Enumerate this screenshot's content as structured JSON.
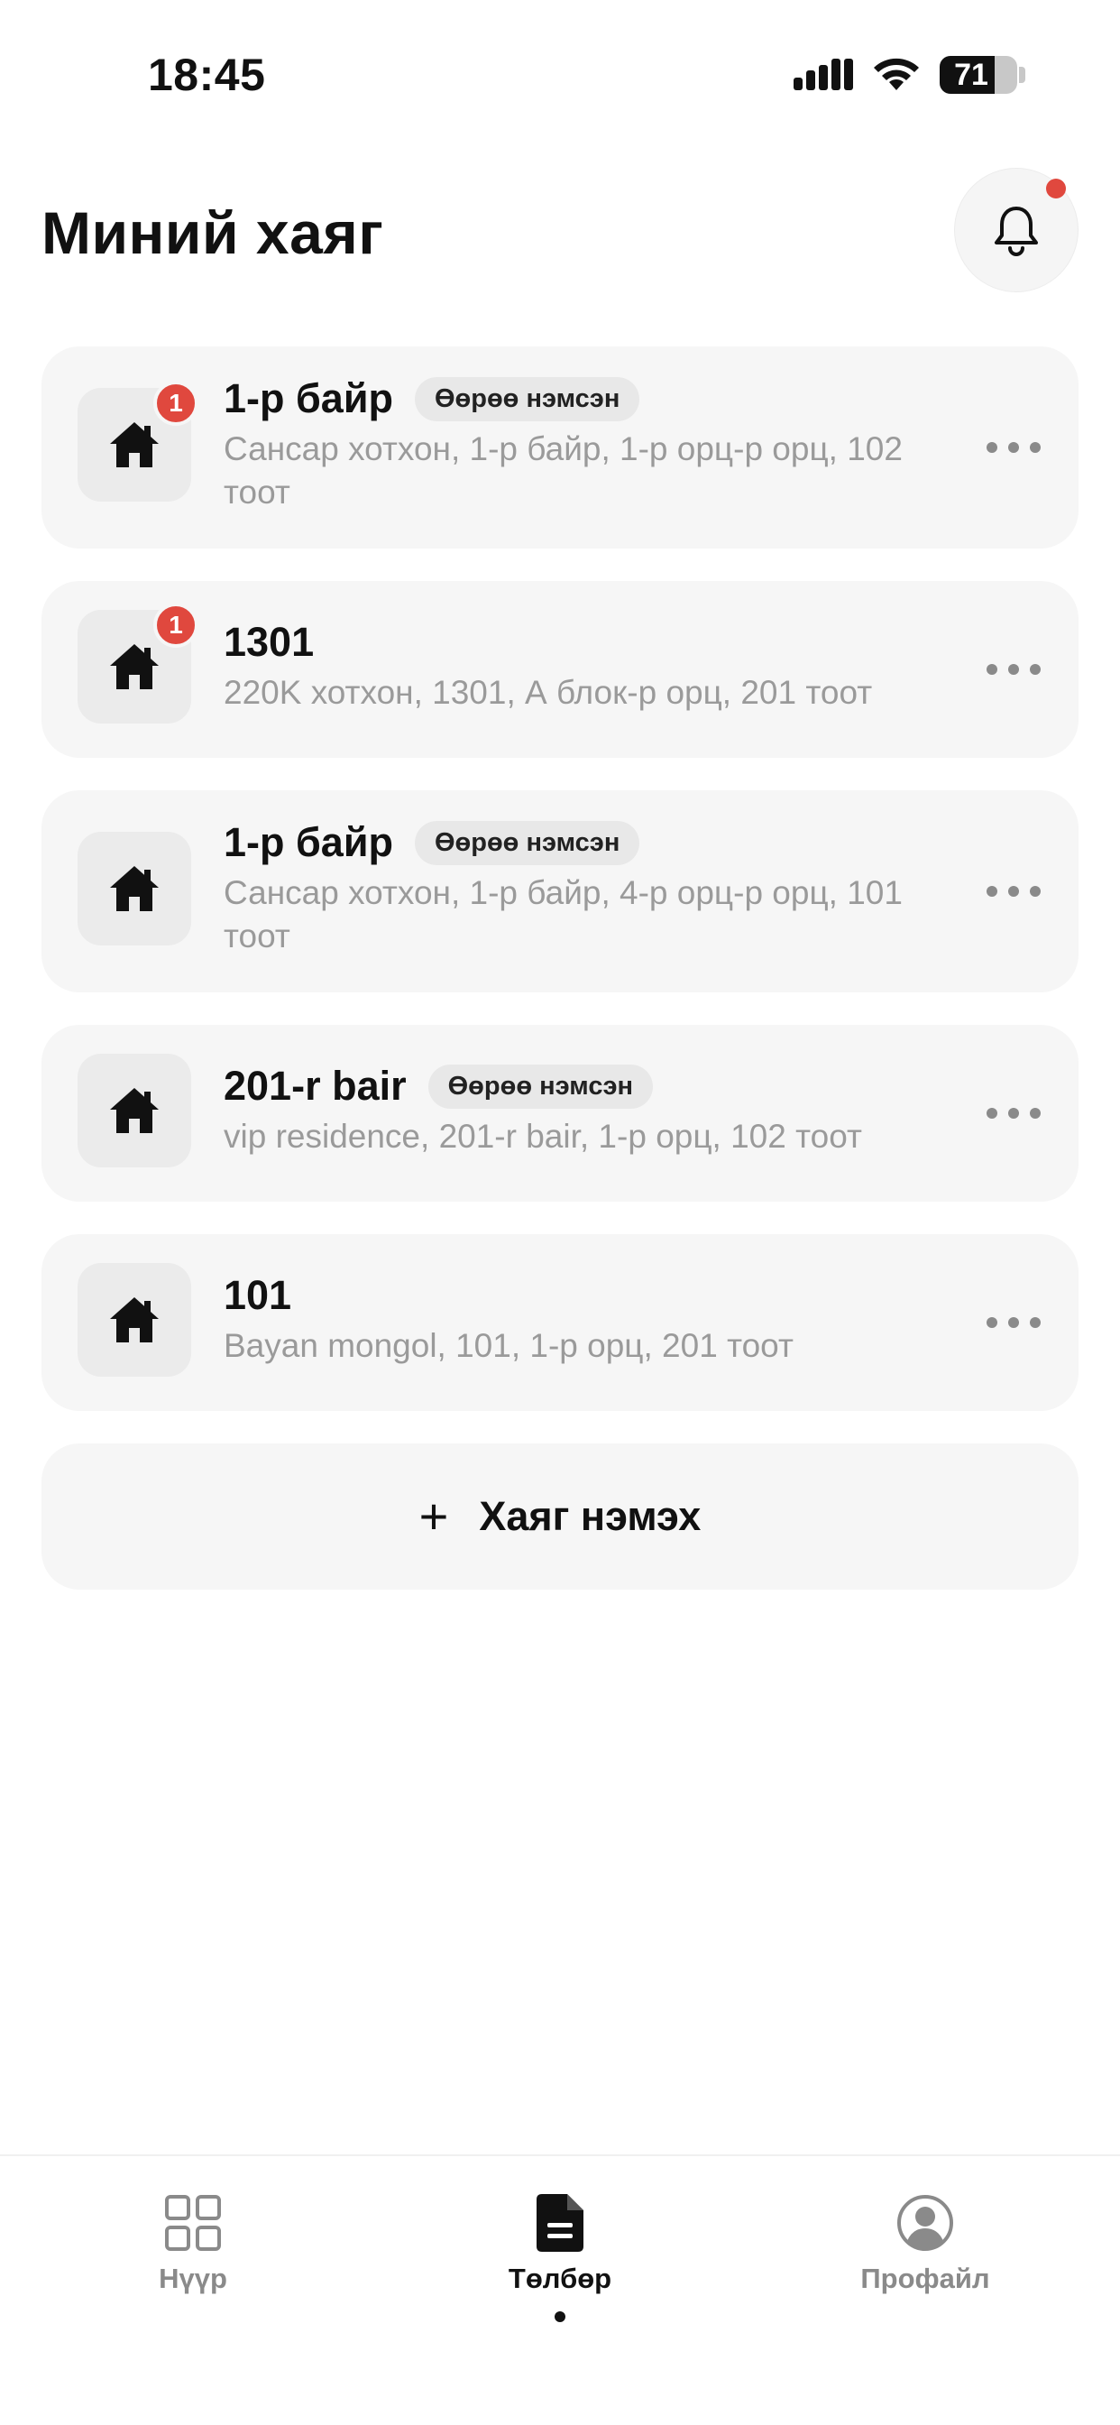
{
  "status_bar": {
    "time": "18:45",
    "battery": "71"
  },
  "header": {
    "title": "Миний хаяг"
  },
  "addresses": [
    {
      "title": "1-р байр",
      "tag": "Өөрөө нэмсэн",
      "subtitle": "Сансар хотхон, 1-р байр, 1-р орц-р орц, 102 тоот",
      "badge": "1"
    },
    {
      "title": "1301",
      "tag": "",
      "subtitle": "220K хотхон, 1301, А блок-р орц, 201 тоот",
      "badge": "1"
    },
    {
      "title": "1-р байр",
      "tag": "Өөрөө нэмсэн",
      "subtitle": "Сансар хотхон, 1-р байр, 4-р орц-р орц, 101 тоот",
      "badge": ""
    },
    {
      "title": "201-r bair",
      "tag": "Өөрөө нэмсэн",
      "subtitle": "vip residence, 201-r bair, 1-р орц, 102 тоот",
      "badge": ""
    },
    {
      "title": "101",
      "tag": "",
      "subtitle": "Bayan mongol, 101, 1-р орц, 201 тоот",
      "badge": ""
    }
  ],
  "add_button": {
    "label": "Хаяг нэмэх"
  },
  "nav": {
    "home": "Нүүр",
    "payment": "Төлбөр",
    "profile": "Профайл"
  },
  "icons": {
    "house": "house-icon",
    "bell": "bell-icon",
    "grid": "grid-icon",
    "document": "document-icon",
    "user": "user-circle-icon"
  },
  "colors": {
    "badge": "#e0483e",
    "card_bg": "#f6f6f6",
    "muted_text": "#9a9a9a"
  }
}
